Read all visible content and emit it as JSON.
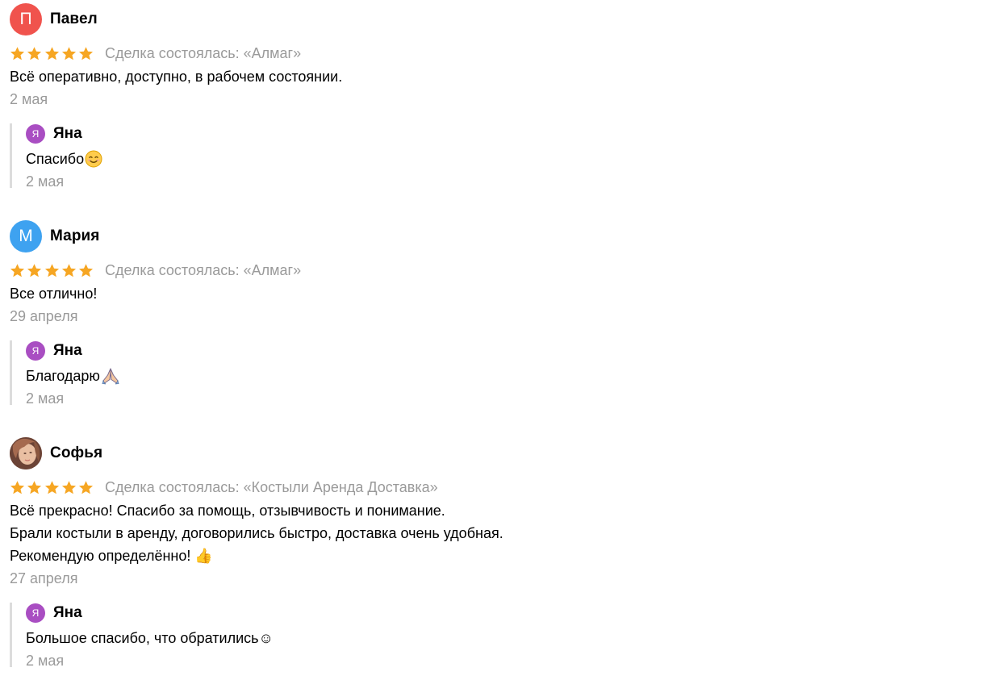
{
  "reviews": [
    {
      "author": {
        "initial": "П",
        "name": "Павел",
        "avatar_color": "#f0534d"
      },
      "rating": 5,
      "deal": "Сделка состоялась: «Алмаг»",
      "text_lines": [
        "Всё оперативно, доступно, в рабочем состоянии."
      ],
      "date": "2 мая",
      "reply": {
        "author": {
          "initial": "Я",
          "name": "Яна",
          "avatar_color": "#a94ec2"
        },
        "text": "Спасибо",
        "emoji": "smiling-face-icon",
        "date": "2 мая"
      }
    },
    {
      "author": {
        "initial": "М",
        "name": "Мария",
        "avatar_color": "#3ea2f0"
      },
      "rating": 5,
      "deal": "Сделка состоялась: «Алмаг»",
      "text_lines": [
        "Все отлично!"
      ],
      "date": "29 апреля",
      "reply": {
        "author": {
          "initial": "Я",
          "name": "Яна",
          "avatar_color": "#a94ec2"
        },
        "text": "Благодарю",
        "emoji": "folded-hands-icon",
        "date": "2 мая"
      }
    },
    {
      "author": {
        "initial": "",
        "name": "Софья",
        "avatar_color": "#c99176"
      },
      "rating": 5,
      "deal": "Сделка состоялась: «Костыли Аренда Доставка»",
      "text_lines": [
        "Всё прекрасно! Спасибо за помощь, отзывчивость и понимание.",
        "Брали костыли в аренду, договорились быстро, доставка очень удобная.",
        "Рекомендую определённо! 👍"
      ],
      "date": "27 апреля",
      "reply": {
        "author": {
          "initial": "Я",
          "name": "Яна",
          "avatar_color": "#a94ec2"
        },
        "text": "Большое спасибо, что обратились☺",
        "emoji": "",
        "date": "2 мая"
      }
    }
  ],
  "colors": {
    "star": "#f6a623",
    "muted_text": "#9a9a9a",
    "reply_border": "#dcdcdc"
  }
}
